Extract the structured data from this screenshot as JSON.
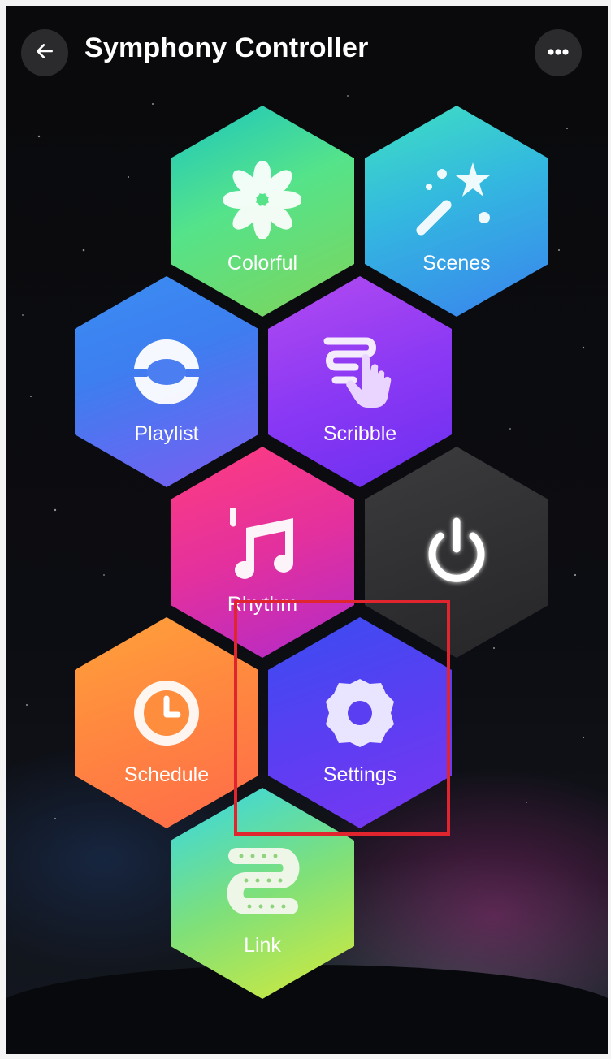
{
  "header": {
    "title": "Symphony Controller",
    "back_icon": "arrow-left-icon",
    "more_icon": "more-horizontal-icon"
  },
  "tiles": [
    {
      "id": "colorful",
      "label": "Colorful",
      "icon": "flower-icon"
    },
    {
      "id": "scenes",
      "label": "Scenes",
      "icon": "magic-wand-icon"
    },
    {
      "id": "playlist",
      "label": "Playlist",
      "icon": "cycle-arrows-icon"
    },
    {
      "id": "scribble",
      "label": "Scribble",
      "icon": "hand-scribble-icon"
    },
    {
      "id": "rhythm",
      "label": "Rhythm",
      "icon": "music-note-icon"
    },
    {
      "id": "power",
      "label": "",
      "icon": "power-icon"
    },
    {
      "id": "schedule",
      "label": "Schedule",
      "icon": "clock-icon"
    },
    {
      "id": "settings",
      "label": "Settings",
      "icon": "gear-icon"
    },
    {
      "id": "link",
      "label": "Link",
      "icon": "led-strip-icon"
    }
  ],
  "colors": {
    "background": "#0a0a0c",
    "highlight_box": "#e0252e",
    "header_button": "#2b2b2e"
  }
}
